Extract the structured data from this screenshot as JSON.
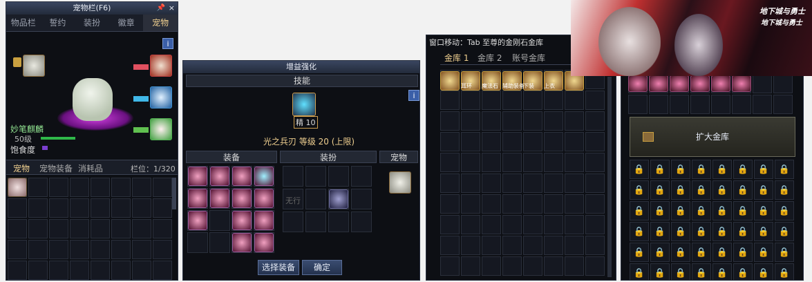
{
  "pet_panel": {
    "title": "宠物栏(F6)",
    "tabs": [
      "物品栏",
      "誓约",
      "装扮",
      "徽章",
      "宠物"
    ],
    "pet_name": "妙笔麒麟",
    "level": "50级",
    "satiety_label": "饱食度",
    "bottom_tabs": [
      "宠物",
      "宠物装备",
      "消耗品"
    ],
    "slot_label": "栏位：1/320",
    "info_label": "i"
  },
  "enhance_panel": {
    "title": "增益强化",
    "skill_header": "技能",
    "skill_badge": "精 10",
    "skill_line": "光之兵刃 等级 20 (上限)",
    "equip_header": "装备",
    "costume_header": "装扮",
    "pet_header": "宠物",
    "none_label": "无行",
    "select_button": "选择装备",
    "confirm_button": "确定",
    "info_label": "i"
  },
  "bank_panel": {
    "header_text": "窗口移动：Tab  至尊的金刚石金库",
    "tabs": [
      "金库 1",
      "金库 2",
      "账号金库"
    ],
    "item_labels": [
      "耳环",
      "魔法石",
      "辅助装备",
      "下装",
      "上衣"
    ]
  },
  "expand_panel": {
    "expand_button": "扩大金库"
  },
  "banner": {
    "logo_text_1": "地下城与勇士",
    "logo_text_2": "地下城与勇士"
  },
  "colors": {
    "gold_text": "#f0d090",
    "green_text": "#8fe08f",
    "hp_bar": "#2fb84a",
    "satiety_bar": "#7a3fd0",
    "pet_name": "#8fe08f"
  }
}
